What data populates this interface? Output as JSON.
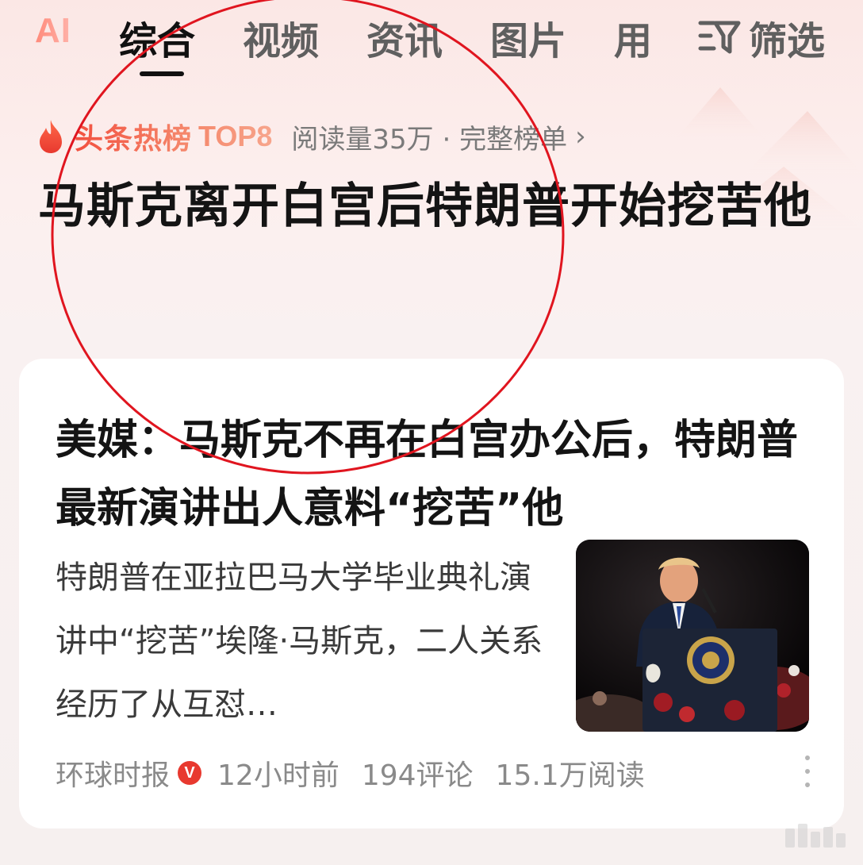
{
  "tabs": {
    "ai": "AI",
    "items": [
      "综合",
      "视频",
      "资讯",
      "图片",
      "用"
    ],
    "active_index": 0,
    "filter_label": "筛选"
  },
  "hot": {
    "label": "头条热榜",
    "rank": "TOP8",
    "meta": "阅读量35万 · 完整榜单",
    "chevron": "›"
  },
  "headline": "马斯克离开白宫后特朗普开始挖苦他",
  "card": {
    "title": "美媒：马斯克不再在白宫办公后，特朗普最新演讲出人意料“挖苦”他",
    "summary": "特朗普在亚拉巴马大学毕业典礼演讲中“挖苦”埃隆·马斯克，二人关系经历了从互怼…",
    "source": "环球时报",
    "verified_badge": "V",
    "time": "12小时前",
    "comments": "194评论",
    "reads": "15.1万阅读"
  },
  "colors": {
    "accent": "#f05a4a",
    "annotation": "#e0151f",
    "background": "#fbe9e7"
  },
  "icons": {
    "filter": "filter-funnel-icon",
    "hot": "flame-icon",
    "more": "more-dots-icon",
    "verified": "verified-badge-icon"
  }
}
